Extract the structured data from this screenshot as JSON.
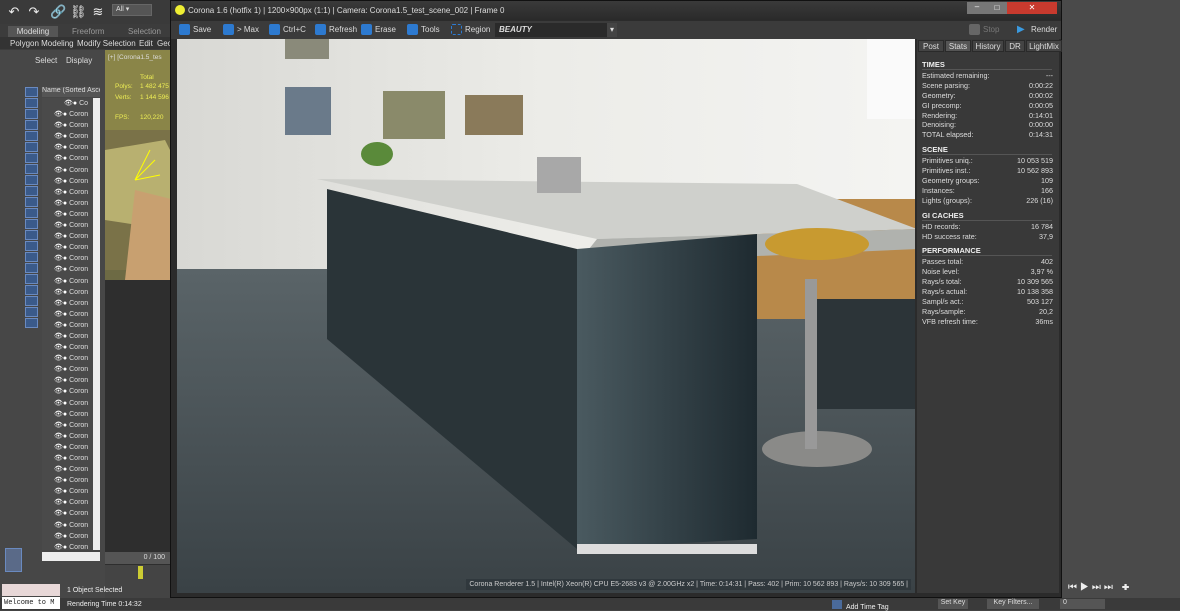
{
  "main_toolbar": {
    "selection_filter": "All"
  },
  "ribbon": {
    "tabs": [
      "Modeling",
      "Freeform",
      "Selection"
    ],
    "subtabs": [
      "Polygon Modeling",
      "Modify Selection",
      "Edit",
      "Geo"
    ]
  },
  "scene_explorer": {
    "menu": [
      "Select",
      "Display"
    ],
    "column_header": "Name (Sorted Ascer",
    "rows": [
      "Co",
      "Coron",
      "Coron",
      "Coron",
      "Coron",
      "Coron",
      "Coron",
      "Coron",
      "Coron",
      "Coron",
      "Coron",
      "Coron",
      "Coron",
      "Coron",
      "Coron",
      "Coron",
      "Coron",
      "Coron",
      "Coron",
      "Coron",
      "Coron",
      "Coron",
      "Coron",
      "Coron",
      "Coron",
      "Coron",
      "Coron",
      "Coron",
      "Coron",
      "Coron",
      "Coron",
      "Coron",
      "Coron",
      "Coron",
      "Coron",
      "Coron",
      "Coron",
      "Coron",
      "Coron",
      "Coron",
      "Coron"
    ]
  },
  "viewport": {
    "label": "[+] [Corona1.5_tes",
    "stats_header": "Total",
    "polys_label": "Polys:",
    "polys": "1 482 475",
    "verts_label": "Verts:",
    "verts": "1 144 596",
    "fps_label": "FPS:",
    "fps": "120,220",
    "frame": "0 / 100"
  },
  "vfb": {
    "title": "Corona 1.6 (hotfix 1) | 1200×900px (1:1) | Camera: Corona1.5_test_scene_002 | Frame 0",
    "toolbar": [
      "Save",
      "> Max",
      "Ctrl+C",
      "Refresh",
      "Erase",
      "Tools",
      "Region"
    ],
    "render_element": "BEAUTY",
    "stop_label": "Stop",
    "render_label": "Render",
    "tabs": [
      "Post",
      "Stats",
      "History",
      "DR",
      "LightMix"
    ],
    "active_tab": "Stats",
    "sections": [
      {
        "title": "TIMES",
        "rows": [
          [
            "Estimated remaining:",
            "---"
          ],
          [
            "Scene parsing:",
            "0:00:22"
          ],
          [
            "Geometry:",
            "0:00:02"
          ],
          [
            "GI precomp:",
            "0:00:05"
          ],
          [
            "Rendering:",
            "0:14:01"
          ],
          [
            "Denoising:",
            "0:00:00"
          ],
          [
            "TOTAL elapsed:",
            "0:14:31"
          ]
        ]
      },
      {
        "title": "SCENE",
        "rows": [
          [
            "Primitives uniq.:",
            "10 053 519"
          ],
          [
            "Primitives inst.:",
            "10 562 893"
          ],
          [
            "Geometry groups:",
            "109"
          ],
          [
            "Instances:",
            "166"
          ],
          [
            "Lights (groups):",
            "226 (16)"
          ]
        ]
      },
      {
        "title": "GI CACHES",
        "rows": [
          [
            "HD records:",
            "16 784"
          ],
          [
            "HD success rate:",
            "37,9"
          ]
        ]
      },
      {
        "title": "PERFORMANCE",
        "rows": [
          [
            "Passes total:",
            "402"
          ],
          [
            "Noise level:",
            "3,97 %"
          ],
          [
            "Rays/s total:",
            "10 309 565"
          ],
          [
            "Rays/s actual:",
            "10 138 358"
          ],
          [
            "Sampl/s act.:",
            "503 127"
          ],
          [
            "Rays/sample:",
            "20,2"
          ],
          [
            "VFB refresh time:",
            "36ms"
          ]
        ]
      }
    ],
    "info_bar": "Corona Renderer 1.5 | Intel(R) Xeon(R) CPU E5-2683 v3 @ 2.00GHz x2 | Time: 0:14:31 | Pass: 402 | Prim: 10 562 893 | Rays/s: 10 309 565 |"
  },
  "status": {
    "listener": "Welcome to M",
    "selected": "1 Object Selected",
    "rendering_time": "Rendering Time  0:14:32",
    "add_time_tag": "Add Time Tag",
    "set_key": "Set Key",
    "key_filters": "Key Filters...",
    "frame_field": "0"
  }
}
